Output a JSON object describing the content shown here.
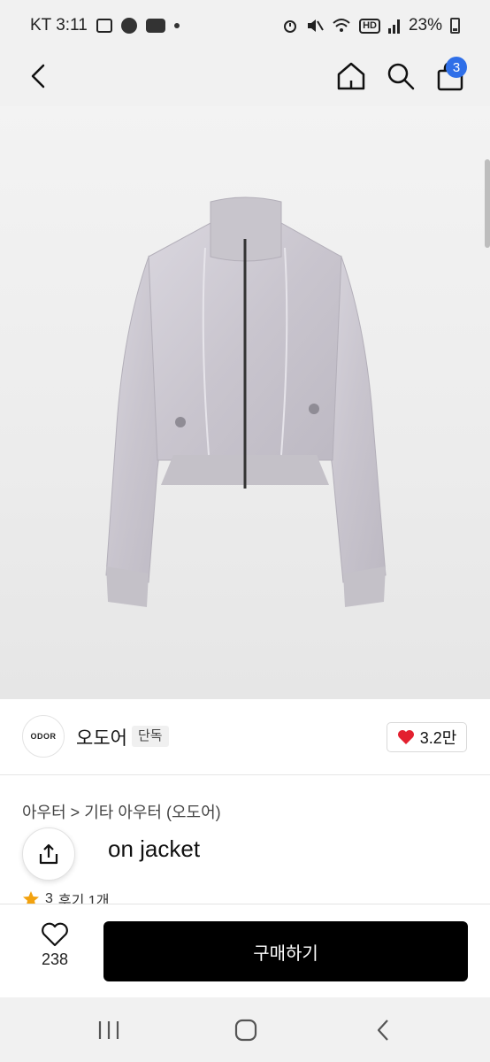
{
  "status_bar": {
    "carrier_time": "KT 3:11",
    "battery": "23%",
    "hd_label": "HD",
    "icons": [
      "gallery-icon",
      "starbucks-icon",
      "ably-icon",
      "dot-icon",
      "alarm-icon",
      "mute-icon",
      "wifi-icon",
      "signal-icon",
      "battery-icon"
    ]
  },
  "header": {
    "icons": [
      "back-icon",
      "home-icon",
      "search-icon",
      "cart-icon"
    ],
    "cart_badge": "3",
    "accent": "#2f6fe8"
  },
  "product": {
    "image_alt": "grey cropped zip jacket",
    "logo_text": "ODOR",
    "shop_name": "오도어",
    "exclusive_label": "단독",
    "likes": "3.2만",
    "breadcrumb": "아우터 > 기타 아우터 (오도어)",
    "title": "on jacket",
    "rating": "3",
    "reviews": "후기 1개"
  },
  "action_bar": {
    "wish_count": "238",
    "buy_label": "구매하기",
    "buy_color": "#000000"
  },
  "nav_bar": {
    "icons": [
      "recent-apps-icon",
      "home-nav-icon",
      "back-nav-icon"
    ]
  }
}
